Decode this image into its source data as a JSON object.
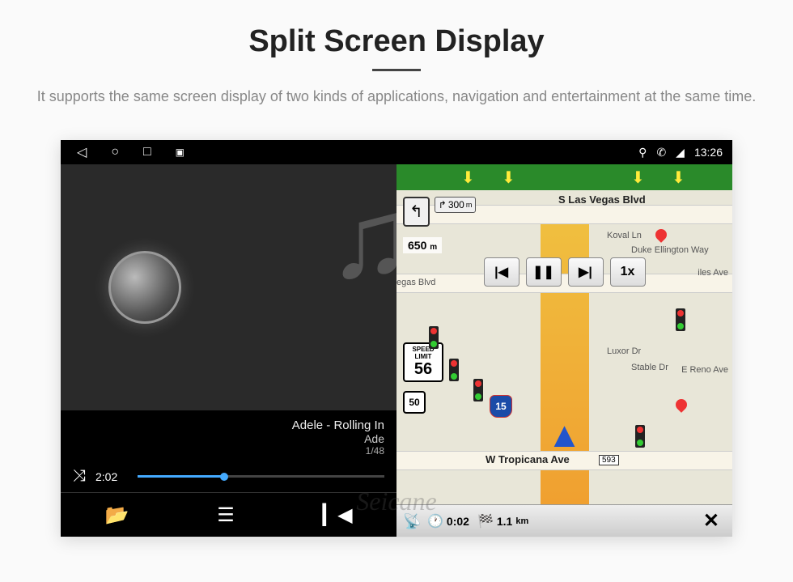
{
  "header": {
    "title": "Split Screen Display",
    "subtitle": "It supports the same screen display of two kinds of applications, navigation and entertainment at the same time."
  },
  "statusbar": {
    "clock": "13:26"
  },
  "music": {
    "track_title": "Adele - Rolling In",
    "track_artist": "Ade",
    "track_count": "1/48",
    "elapsed": "2:02"
  },
  "nav": {
    "turn_next_dist": "300",
    "turn_next_unit": "m",
    "turn_main_dist": "650",
    "turn_main_unit": "m",
    "speed_limit_label": "SPEED LIMIT",
    "speed_limit_value": "56",
    "route_50": "50",
    "interstate_15": "15",
    "speed_1x": "1x",
    "streets": {
      "s_las_vegas": "S Las Vegas Blvd",
      "koval": "Koval Ln",
      "duke": "Duke Ellington Way",
      "vegas_blvd": "egas Blvd",
      "luxor": "Luxor Dr",
      "stable": "Stable Dr",
      "reno": "E Reno Ave",
      "tropicana": "W Tropicana Ave",
      "trop_num": "593",
      "iles": "iles Ave"
    },
    "bottom": {
      "time_to": "0:02",
      "dist_to": "1.1",
      "dist_unit": "km"
    }
  },
  "watermark": "Seicane"
}
